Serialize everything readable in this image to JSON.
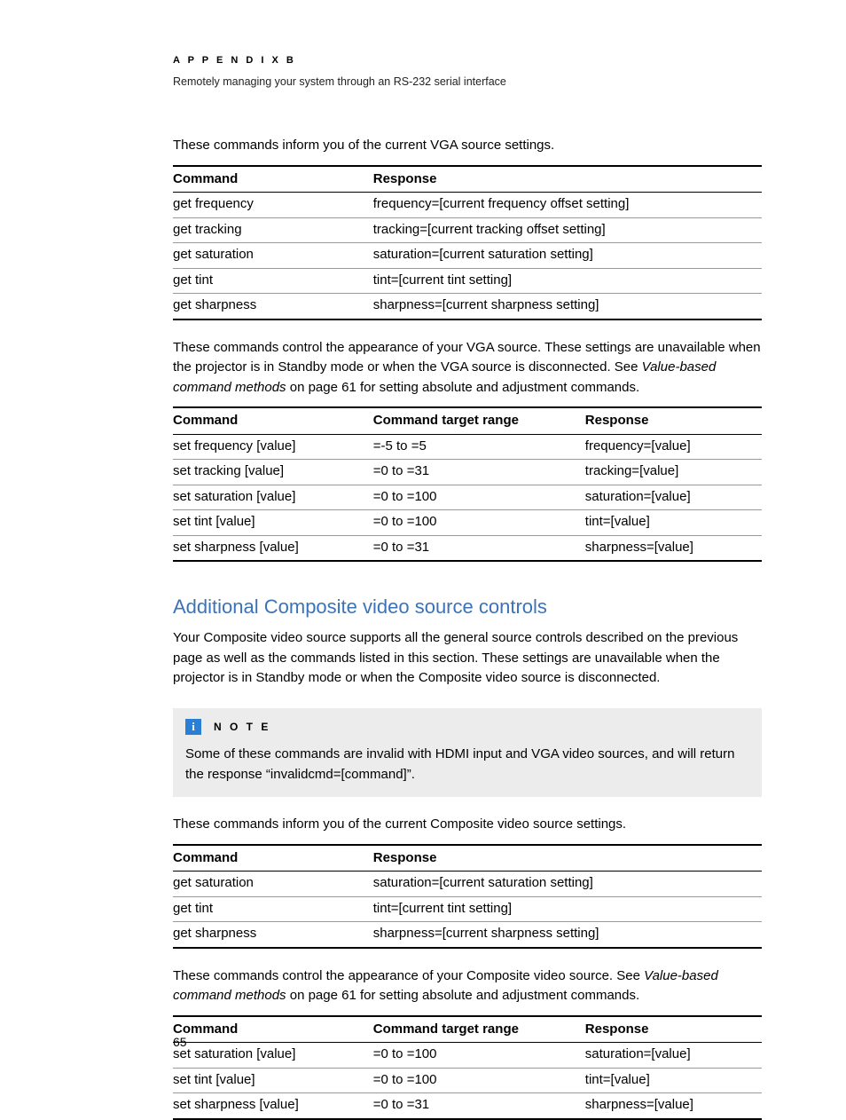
{
  "header": {
    "appendix": "A P P E N D I X   B",
    "subtitle": "Remotely managing your system through an RS-232 serial interface"
  },
  "intro1": "These commands inform you of the current VGA source settings.",
  "table1": {
    "headers": [
      "Command",
      "Response"
    ],
    "rows": [
      [
        "get frequency",
        "frequency=[current frequency offset setting]"
      ],
      [
        "get tracking",
        "tracking=[current tracking offset setting]"
      ],
      [
        "get saturation",
        "saturation=[current saturation setting]"
      ],
      [
        "get tint",
        "tint=[current tint setting]"
      ],
      [
        "get sharpness",
        "sharpness=[current sharpness setting]"
      ]
    ]
  },
  "para2a": "These commands control the appearance of your VGA source. These settings are unavailable when the projector is in Standby mode or when the VGA source is disconnected. See ",
  "para2_link": "Value-based command methods",
  "para2b": " on page 61 for setting absolute and adjustment commands.",
  "table2": {
    "headers": [
      "Command",
      "Command target range",
      "Response"
    ],
    "rows": [
      [
        "set frequency [value]",
        "=-5 to =5",
        "frequency=[value]"
      ],
      [
        "set tracking [value]",
        "=0 to =31",
        "tracking=[value]"
      ],
      [
        "set saturation [value]",
        "=0 to =100",
        "saturation=[value]"
      ],
      [
        "set tint [value]",
        "=0 to =100",
        "tint=[value]"
      ],
      [
        "set sharpness [value]",
        "=0 to =31",
        "sharpness=[value]"
      ]
    ]
  },
  "section_heading": "Additional Composite video source controls",
  "section_para": "Your Composite video source supports all the general source controls described on the previous page as well as the commands listed in this section. These settings are unavailable when the projector is in Standby mode or when the Composite video source is disconnected.",
  "note": {
    "icon": "i",
    "label": "N O T E",
    "body": "Some of these commands are invalid with HDMI input and VGA video sources, and will return the response “invalidcmd=[command]”."
  },
  "intro3": "These commands inform you of the current Composite video source settings.",
  "table3": {
    "headers": [
      "Command",
      "Response"
    ],
    "rows": [
      [
        "get saturation",
        "saturation=[current saturation setting]"
      ],
      [
        "get tint",
        "tint=[current tint setting]"
      ],
      [
        "get sharpness",
        "sharpness=[current sharpness setting]"
      ]
    ]
  },
  "para4a": "These commands control the appearance of your Composite video source. See ",
  "para4_link": "Value-based command methods",
  "para4b": " on page 61 for setting absolute and adjustment commands.",
  "table4": {
    "headers": [
      "Command",
      "Command target range",
      "Response"
    ],
    "rows": [
      [
        "set saturation [value]",
        "=0 to =100",
        "saturation=[value]"
      ],
      [
        "set tint [value]",
        "=0 to =100",
        "tint=[value]"
      ],
      [
        "set sharpness [value]",
        "=0 to =31",
        "sharpness=[value]"
      ]
    ]
  },
  "page_number": "65"
}
